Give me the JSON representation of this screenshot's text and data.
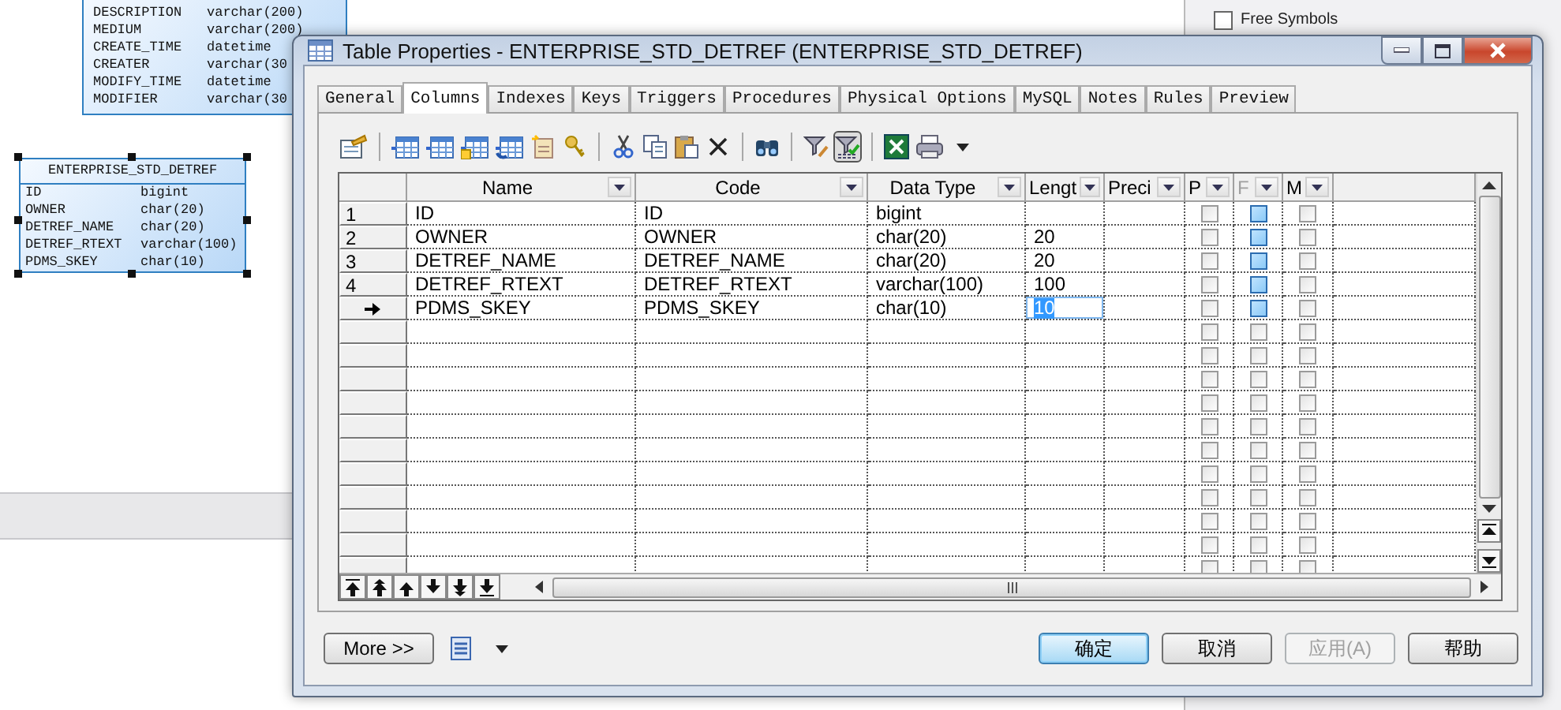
{
  "background_entity": {
    "rows": [
      {
        "name": "DESCRIPTION",
        "type": "varchar(200)"
      },
      {
        "name": "MEDIUM",
        "type": "varchar(200)"
      },
      {
        "name": "CREATE_TIME",
        "type": "datetime"
      },
      {
        "name": "CREATER",
        "type": "varchar(30"
      },
      {
        "name": "MODIFY_TIME",
        "type": "datetime"
      },
      {
        "name": "MODIFIER",
        "type": "varchar(30"
      }
    ]
  },
  "selected_entity": {
    "title": "ENTERPRISE_STD_DETREF",
    "selected": true,
    "rows": [
      {
        "name": "ID",
        "type": "bigint"
      },
      {
        "name": "OWNER",
        "type": "char(20)"
      },
      {
        "name": "DETREF_NAME",
        "type": "char(20)"
      },
      {
        "name": "DETREF_RTEXT",
        "type": "varchar(100)"
      },
      {
        "name": "PDMS_SKEY",
        "type": "char(10)"
      }
    ]
  },
  "side_panel": {
    "title": "Free Symbols"
  },
  "dialog": {
    "title": "Table Properties - ENTERPRISE_STD_DETREF (ENTERPRISE_STD_DETREF)",
    "tabs": [
      {
        "label": "General",
        "selected": false
      },
      {
        "label": "Columns",
        "selected": true
      },
      {
        "label": "Indexes",
        "selected": false
      },
      {
        "label": "Keys",
        "selected": false
      },
      {
        "label": "Triggers",
        "selected": false
      },
      {
        "label": "Procedures",
        "selected": false
      },
      {
        "label": "Physical Options",
        "selected": false
      },
      {
        "label": "MySQL",
        "selected": false
      },
      {
        "label": "Notes",
        "selected": false
      },
      {
        "label": "Rules",
        "selected": false
      },
      {
        "label": "Preview",
        "selected": false
      }
    ],
    "toolbar": {
      "filter_pressed": true
    },
    "grid": {
      "columns": [
        {
          "label": "Name",
          "focused": false
        },
        {
          "label": "Code",
          "focused": false
        },
        {
          "label": "Data Type",
          "focused": false
        },
        {
          "label": "Lengt",
          "focused": false
        },
        {
          "label": "Preci",
          "focused": false
        },
        {
          "label": "P",
          "focused": false
        },
        {
          "label": "F",
          "focused": true
        },
        {
          "label": "M",
          "focused": false
        }
      ],
      "rows": [
        {
          "number": "1",
          "name": "ID",
          "code": "ID",
          "data_type": "bigint",
          "current": false,
          "editing": false,
          "p": false,
          "f": false,
          "m": false
        },
        {
          "number": "2",
          "name": "OWNER",
          "code": "OWNER",
          "data_type": "char(20)",
          "length": "20",
          "current": false,
          "editing": false,
          "p": false,
          "f": false,
          "m": false
        },
        {
          "number": "3",
          "name": "DETREF_NAME",
          "code": "DETREF_NAME",
          "data_type": "char(20)",
          "length": "20",
          "current": false,
          "editing": false,
          "p": false,
          "f": false,
          "m": false
        },
        {
          "number": "4",
          "name": "DETREF_RTEXT",
          "code": "DETREF_RTEXT",
          "data_type": "varchar(100)",
          "length": "100",
          "current": false,
          "editing": false,
          "p": false,
          "f": false,
          "m": false
        },
        {
          "name": "PDMS_SKEY",
          "code": "PDMS_SKEY",
          "data_type": "char(10)",
          "length": "10",
          "current": true,
          "editing": true,
          "p": false,
          "f": false,
          "m": false
        },
        {
          "p": false,
          "f": false,
          "m": false
        },
        {
          "p": false,
          "f": false,
          "m": false
        },
        {
          "p": false,
          "f": false,
          "m": false
        },
        {
          "p": false,
          "f": false,
          "m": false
        },
        {
          "p": false,
          "f": false,
          "m": false
        },
        {
          "p": false,
          "f": false,
          "m": false
        },
        {
          "p": false,
          "f": false,
          "m": false
        },
        {
          "p": false,
          "f": false,
          "m": false
        },
        {
          "p": false,
          "f": false,
          "m": false
        },
        {
          "p": false,
          "f": false,
          "m": false
        },
        {
          "p": false,
          "f": false,
          "m": false
        }
      ]
    },
    "more_button": "More >>",
    "buttons": [
      {
        "label": "确定",
        "kind": "default",
        "disabled": false
      },
      {
        "label": "取消",
        "kind": "normal",
        "disabled": false
      },
      {
        "label": "应用(A)",
        "kind": "normal",
        "disabled": true
      },
      {
        "label": "帮助",
        "kind": "normal",
        "disabled": false
      }
    ]
  }
}
